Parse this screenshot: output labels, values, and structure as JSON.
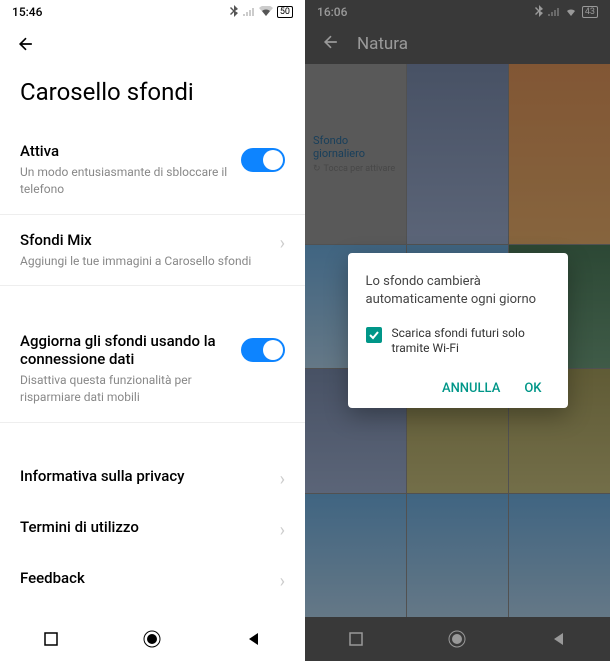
{
  "left": {
    "status": {
      "time": "15:46",
      "battery": "50"
    },
    "title": "Carosello sfondi",
    "settings": {
      "activate": {
        "title": "Attiva",
        "subtitle": "Un modo entusiasmante di sbloccare il telefono"
      },
      "mix": {
        "title": "Sfondi Mix",
        "subtitle": "Aggiungi le tue immagini a Carosello sfondi"
      },
      "data": {
        "title": "Aggiorna gli sfondi usando la connessione dati",
        "subtitle": "Disattiva questa funzionalità per risparmiare dati mobili"
      }
    },
    "links": {
      "privacy": "Informativa sulla privacy",
      "terms": "Termini di utilizzo",
      "feedback": "Feedback"
    }
  },
  "right": {
    "status": {
      "time": "16:06",
      "battery": "43"
    },
    "title": "Natura",
    "daily": {
      "title": "Sfondo giornaliero",
      "sub": "Tocca per attivare"
    },
    "dialog": {
      "message": "Lo sfondo cambierà automaticamente ogni giorno",
      "checkbox_label": "Scarica sfondi futuri solo tramite Wi-Fi",
      "cancel": "ANNULLA",
      "ok": "OK"
    }
  }
}
